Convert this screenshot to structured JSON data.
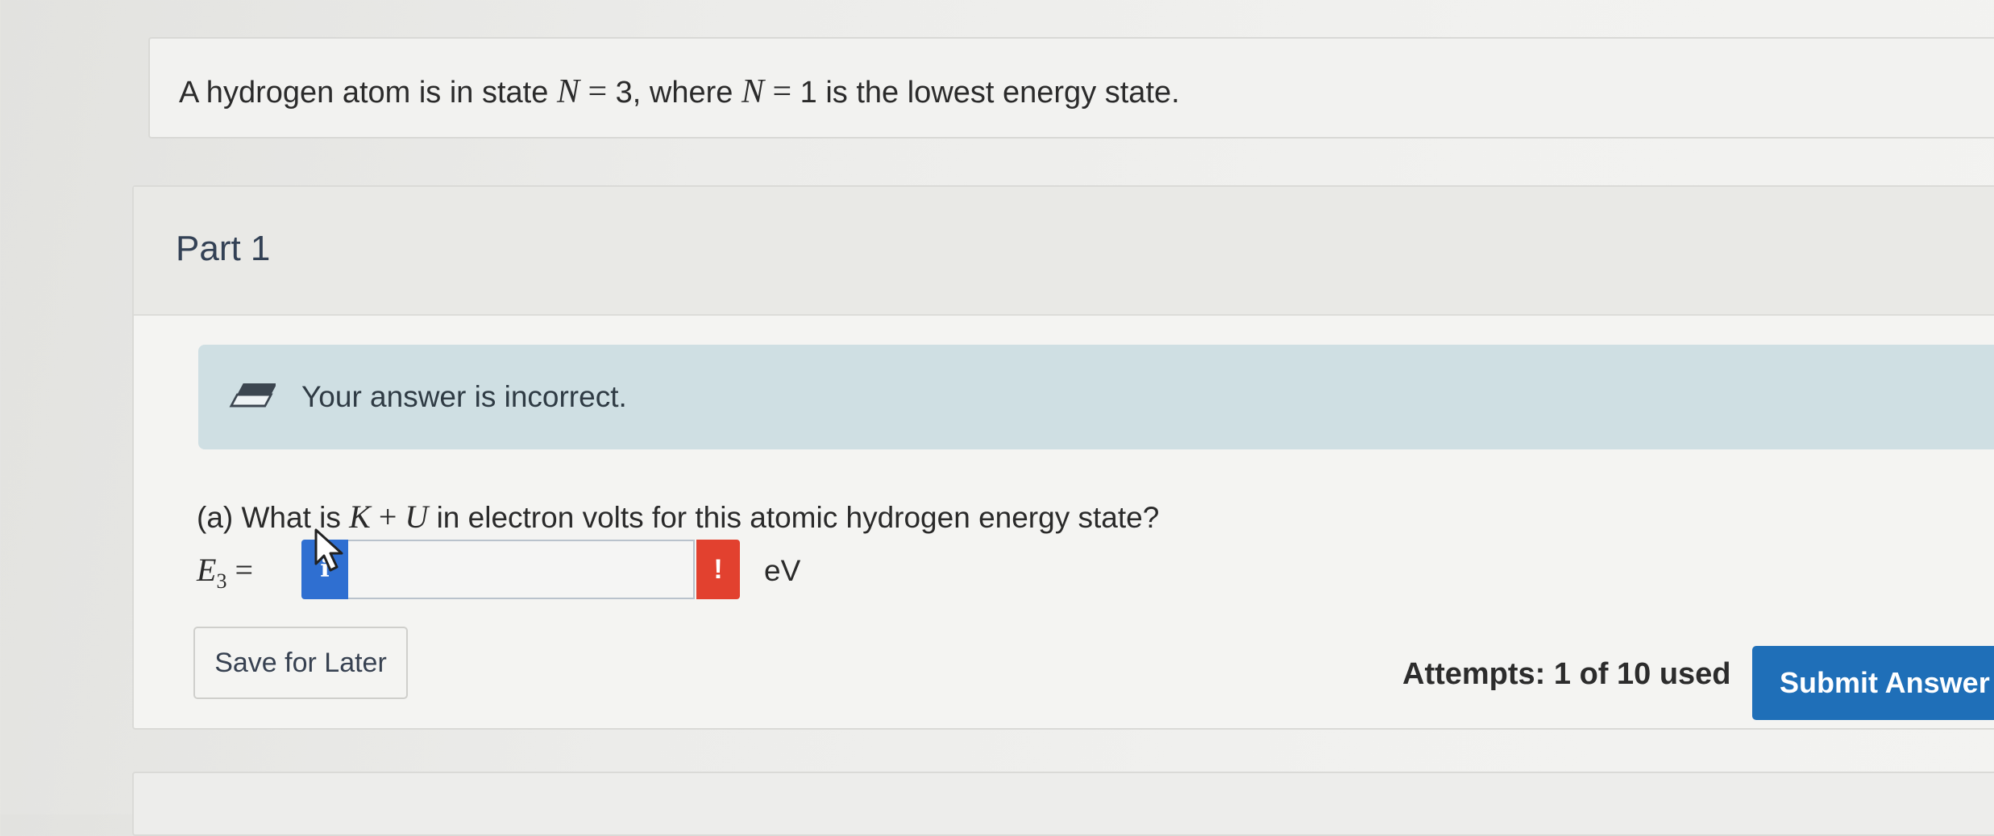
{
  "question": {
    "prefix": "A hydrogen atom is in state ",
    "var1": "N",
    "eq1": " = ",
    "val1": "3",
    "mid": ", where ",
    "var2": "N",
    "eq2": " = ",
    "val2": "1",
    "suffix": " is the lowest energy state."
  },
  "part": {
    "title": "Part 1"
  },
  "feedback": {
    "message": "Your answer is incorrect.",
    "icon": "eraser-icon",
    "color": "#cfdfe3"
  },
  "prompt": {
    "label": "(a)",
    "before": " What is ",
    "var_k": "K",
    "plus": " + ",
    "var_u": "U",
    "after": " in electron volts for this atomic hydrogen energy state?"
  },
  "answer": {
    "symbol": "E",
    "subscript": "3",
    "equals": " =",
    "info_badge": "i",
    "error_badge": "!",
    "value": "",
    "unit": "eV",
    "error_color": "#e2412f",
    "info_color": "#2f6fd1"
  },
  "actions": {
    "save_label": "Save for Later",
    "attempts_text": "Attempts: 1 of 10 used",
    "submit_label": "Submit Answer",
    "submit_color": "#1f6fb8"
  }
}
